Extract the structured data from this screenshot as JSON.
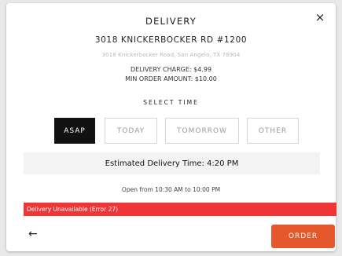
{
  "modal": {
    "title": "DELIVERY",
    "close_icon": "×",
    "address": "3018 KNICKERBOCKER RD #1200",
    "sub_address": "3018 Knickerbocker Road, San Angelo, TX 76904",
    "delivery_charge": "DELIVERY CHARGE: $4.99",
    "min_order": "MIN ORDER AMOUNT: $10.00",
    "select_time_label": "SELECT TIME",
    "tabs": [
      {
        "label": "ASAP",
        "active": true
      },
      {
        "label": "TODAY",
        "active": false
      },
      {
        "label": "TOMORROW",
        "active": false
      },
      {
        "label": "OTHER",
        "active": false
      }
    ],
    "estimated_time": "Estimated Delivery Time: 4:20 PM",
    "open_hours": "Open from 10:30 AM to 10:00 PM",
    "error": "Delivery Unavailable (Error 27)",
    "back_icon": "←",
    "order_label": "ORDER"
  },
  "colors": {
    "accent": "#e4582c",
    "error": "#ef3535",
    "active_tab": "#111111"
  }
}
